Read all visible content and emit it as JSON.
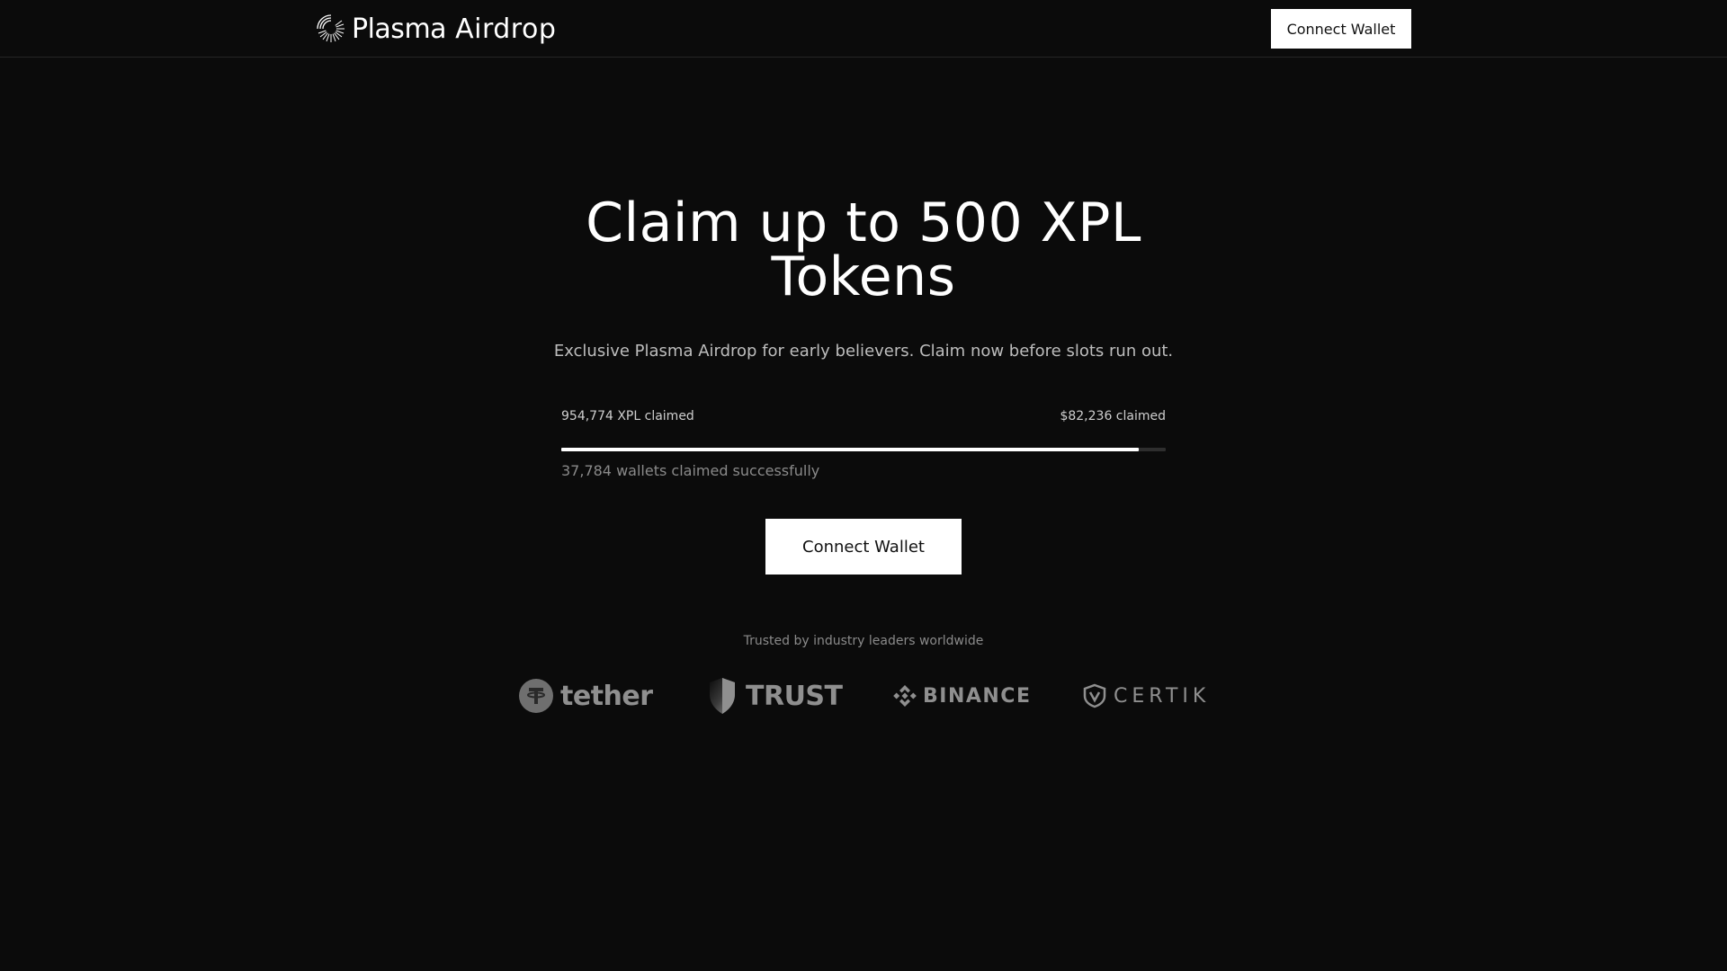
{
  "header": {
    "brand_part1": "Plasma",
    "brand_part2": "Airdrop",
    "connect_label": "Connect Wallet"
  },
  "hero": {
    "title_line1": "Claim up to 500 XPL",
    "title_line2": "Tokens",
    "subtitle": "Exclusive Plasma Airdrop for early believers. Claim now before slots run out."
  },
  "progress": {
    "left_label": "954,774 XPL claimed",
    "right_label": "$82,236 claimed",
    "fill_fraction": 0.955,
    "wallets_text": "37,784 wallets claimed successfully"
  },
  "cta": {
    "connect_label": "Connect Wallet"
  },
  "trusted": {
    "text": "Trusted by industry leaders worldwide",
    "logos": [
      {
        "name": "tether",
        "icon": "tether-icon"
      },
      {
        "name": "TRUST",
        "icon": "trust-shield-icon"
      },
      {
        "name": "BINANCE",
        "icon": "binance-icon"
      },
      {
        "name": "CERTIK",
        "icon": "certik-shield-icon"
      }
    ]
  },
  "colors": {
    "background": "#0b0b0b",
    "button_bg": "#ffffff",
    "button_text": "#111111",
    "muted_text": "#8a8a8a",
    "logo_gray": "#8f8f8f"
  }
}
